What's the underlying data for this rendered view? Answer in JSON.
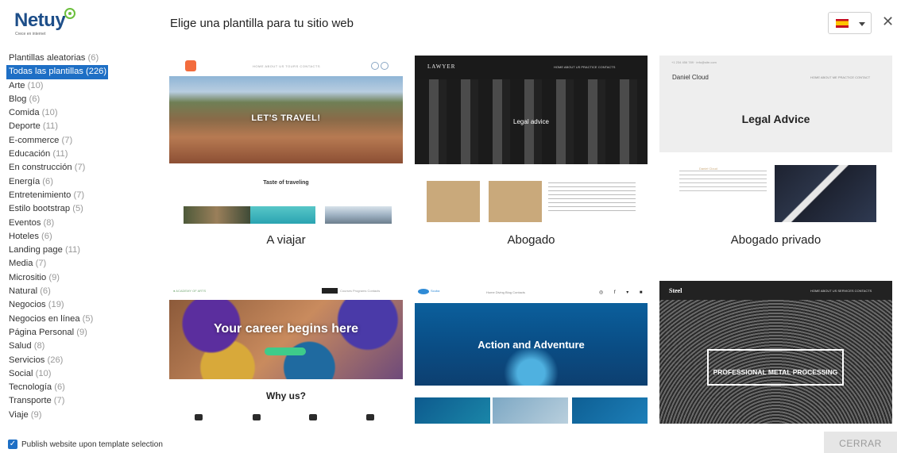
{
  "header": {
    "logo_text": "Netuy",
    "logo_tagline": "Crece en internet",
    "title": "Elige una plantilla para tu sitio web",
    "language_flag": "es-flag-icon"
  },
  "sidebar": {
    "categories": [
      {
        "label": "Plantillas aleatorias",
        "count": "(6)"
      },
      {
        "label": "Todas las plantillas",
        "count": "(226)",
        "active": true
      },
      {
        "label": "Arte",
        "count": "(10)"
      },
      {
        "label": "Blog",
        "count": "(6)"
      },
      {
        "label": "Comida",
        "count": "(10)"
      },
      {
        "label": "Deporte",
        "count": "(11)"
      },
      {
        "label": "E-commerce",
        "count": "(7)"
      },
      {
        "label": "Educación",
        "count": "(11)"
      },
      {
        "label": "En construcción",
        "count": "(7)"
      },
      {
        "label": "Energía",
        "count": "(6)"
      },
      {
        "label": "Entretenimiento",
        "count": "(7)"
      },
      {
        "label": "Estilo bootstrap",
        "count": "(5)"
      },
      {
        "label": "Eventos",
        "count": "(8)"
      },
      {
        "label": "Hoteles",
        "count": "(6)"
      },
      {
        "label": "Landing page",
        "count": "(11)"
      },
      {
        "label": "Media",
        "count": "(7)"
      },
      {
        "label": "Micrositio",
        "count": "(9)"
      },
      {
        "label": "Natural",
        "count": "(6)"
      },
      {
        "label": "Negocios",
        "count": "(19)"
      },
      {
        "label": "Negocios en línea",
        "count": "(5)"
      },
      {
        "label": "Página Personal",
        "count": "(9)"
      },
      {
        "label": "Salud",
        "count": "(8)"
      },
      {
        "label": "Servicios",
        "count": "(26)"
      },
      {
        "label": "Social",
        "count": "(10)"
      },
      {
        "label": "Tecnología",
        "count": "(6)"
      },
      {
        "label": "Transporte",
        "count": "(7)"
      },
      {
        "label": "Viaje",
        "count": "(9)"
      }
    ]
  },
  "templates": {
    "travel": {
      "name": "A viajar",
      "hero": "LET'S TRAVEL!",
      "subtitle": "Taste of traveling"
    },
    "lawyer": {
      "name": "Abogado",
      "brand": "LAWYER",
      "hero": "Legal advice"
    },
    "private_lawyer": {
      "name": "Abogado privado",
      "brand": "Daniel Cloud",
      "hero": "Legal Advice"
    },
    "career": {
      "hero": "Your career begins here",
      "section": "Why us?"
    },
    "adventure": {
      "hero": "Action and Adventure"
    },
    "steel": {
      "brand": "Steel",
      "hero": "PROFESSIONAL METAL PROCESSING"
    }
  },
  "footer": {
    "publish_label": "Publish website upon template selection",
    "publish_checked": true,
    "close_label": "CERRAR"
  },
  "colors": {
    "accent": "#1e6fc5",
    "logo": "#1d4e89",
    "logo_badge": "#6bbf3c"
  }
}
